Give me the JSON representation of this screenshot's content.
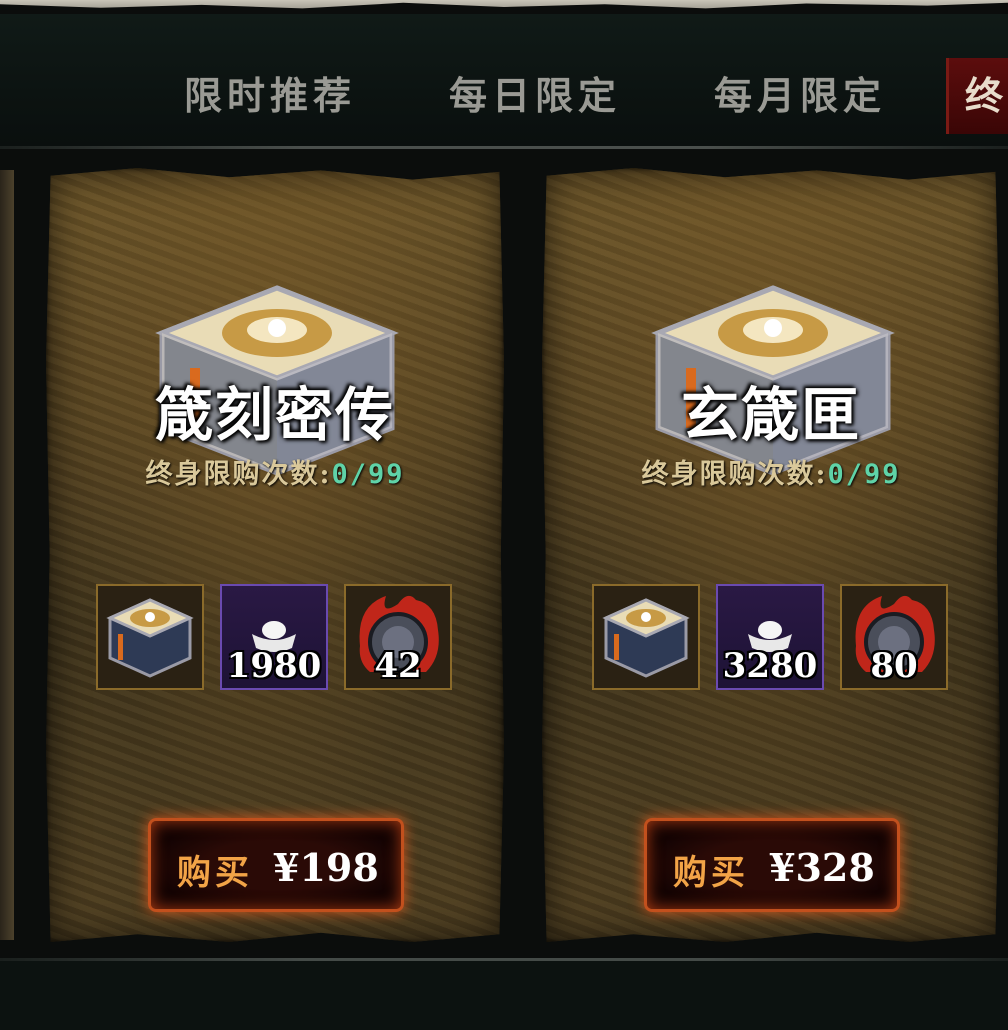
{
  "tabs": [
    {
      "label": "限时推荐"
    },
    {
      "label": "每日限定"
    },
    {
      "label": "每月限定"
    },
    {
      "label": "终"
    }
  ],
  "active_tab_index": 3,
  "packs": [
    {
      "title": "箴刻密传",
      "limit_label": "终身限购次数:",
      "limit_count": "0/99",
      "rewards": [
        {
          "icon": "treasure-box-icon",
          "count": ""
        },
        {
          "icon": "silver-ingot-icon",
          "count": "1980"
        },
        {
          "icon": "flame-orb-icon",
          "count": "42"
        }
      ],
      "buy_label": "购买",
      "price": "¥198"
    },
    {
      "title": "玄箴匣",
      "limit_label": "终身限购次数:",
      "limit_count": "0/99",
      "rewards": [
        {
          "icon": "treasure-box-icon",
          "count": ""
        },
        {
          "icon": "silver-ingot-icon",
          "count": "3280"
        },
        {
          "icon": "flame-orb-icon",
          "count": "80"
        }
      ],
      "buy_label": "购买",
      "price": "¥328"
    }
  ],
  "colors": {
    "accent_orange": "#f2a447",
    "count_green": "#5fd3a8",
    "active_tab": "#5c0d0d",
    "button_glow": "#d2591f"
  }
}
